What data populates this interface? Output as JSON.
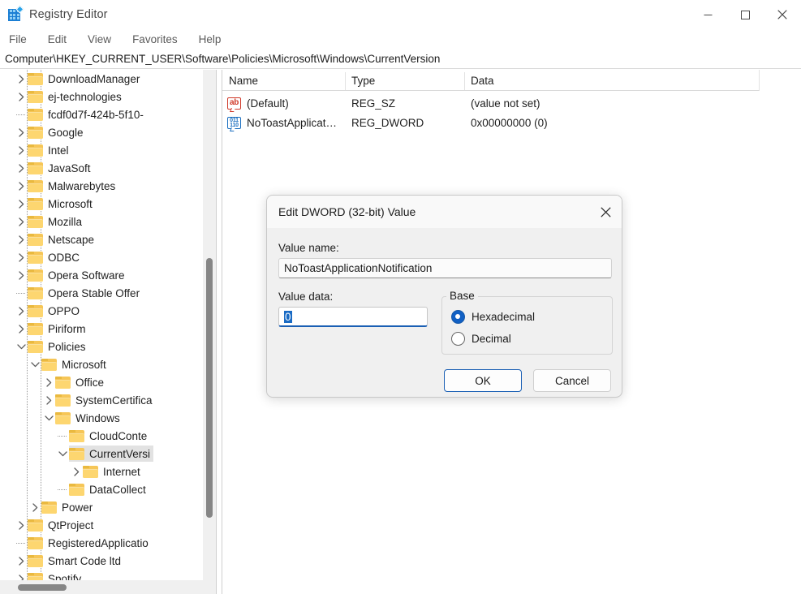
{
  "window": {
    "title": "Registry Editor",
    "icon": "registry-editor-icon",
    "controls": {
      "minimize": "minimize-icon",
      "maximize": "maximize-icon",
      "close": "close-icon"
    }
  },
  "menubar": {
    "items": [
      "File",
      "Edit",
      "View",
      "Favorites",
      "Help"
    ]
  },
  "address": {
    "path": "Computer\\HKEY_CURRENT_USER\\Software\\Policies\\Microsoft\\Windows\\CurrentVersion"
  },
  "tree": {
    "items": [
      {
        "label": "DownloadManager",
        "indent": 2,
        "state": "collapsed",
        "selected": false
      },
      {
        "label": "ej-technologies",
        "indent": 2,
        "state": "collapsed",
        "selected": false
      },
      {
        "label": "fcdf0d7f-424b-5f10-",
        "indent": 2,
        "state": "leaf",
        "selected": false
      },
      {
        "label": "Google",
        "indent": 2,
        "state": "collapsed",
        "selected": false
      },
      {
        "label": "Intel",
        "indent": 2,
        "state": "collapsed",
        "selected": false
      },
      {
        "label": "JavaSoft",
        "indent": 2,
        "state": "collapsed",
        "selected": false
      },
      {
        "label": "Malwarebytes",
        "indent": 2,
        "state": "collapsed",
        "selected": false
      },
      {
        "label": "Microsoft",
        "indent": 2,
        "state": "collapsed",
        "selected": false
      },
      {
        "label": "Mozilla",
        "indent": 2,
        "state": "collapsed",
        "selected": false
      },
      {
        "label": "Netscape",
        "indent": 2,
        "state": "collapsed",
        "selected": false
      },
      {
        "label": "ODBC",
        "indent": 2,
        "state": "collapsed",
        "selected": false
      },
      {
        "label": "Opera Software",
        "indent": 2,
        "state": "collapsed",
        "selected": false
      },
      {
        "label": "Opera Stable Offer",
        "indent": 2,
        "state": "leaf",
        "selected": false
      },
      {
        "label": "OPPO",
        "indent": 2,
        "state": "collapsed",
        "selected": false
      },
      {
        "label": "Piriform",
        "indent": 2,
        "state": "collapsed",
        "selected": false
      },
      {
        "label": "Policies",
        "indent": 2,
        "state": "expanded",
        "selected": false
      },
      {
        "label": "Microsoft",
        "indent": 3,
        "state": "expanded",
        "selected": false
      },
      {
        "label": "Office",
        "indent": 4,
        "state": "collapsed",
        "selected": false
      },
      {
        "label": "SystemCertifica",
        "indent": 4,
        "state": "collapsed",
        "selected": false
      },
      {
        "label": "Windows",
        "indent": 4,
        "state": "expanded",
        "selected": false
      },
      {
        "label": "CloudConte",
        "indent": 5,
        "state": "leaf",
        "selected": false
      },
      {
        "label": "CurrentVersi",
        "indent": 5,
        "state": "expanded",
        "selected": true
      },
      {
        "label": "Internet ",
        "indent": 6,
        "state": "collapsed",
        "selected": false
      },
      {
        "label": "DataCollect",
        "indent": 5,
        "state": "leaf",
        "selected": false
      },
      {
        "label": "Power",
        "indent": 3,
        "state": "collapsed",
        "selected": false
      },
      {
        "label": "QtProject",
        "indent": 2,
        "state": "collapsed",
        "selected": false
      },
      {
        "label": "RegisteredApplicatio",
        "indent": 2,
        "state": "leaf",
        "selected": false
      },
      {
        "label": "Smart Code ltd",
        "indent": 2,
        "state": "collapsed",
        "selected": false
      },
      {
        "label": "Spotify",
        "indent": 2,
        "state": "collapsed",
        "selected": false
      }
    ]
  },
  "values": {
    "columns": [
      "Name",
      "Type",
      "Data"
    ],
    "rows": [
      {
        "icon": "string-value-icon",
        "name": "(Default)",
        "type": "REG_SZ",
        "data": "(value not set)"
      },
      {
        "icon": "dword-value-icon",
        "name": "NoToastApplicat…",
        "type": "REG_DWORD",
        "data": "0x00000000 (0)"
      }
    ]
  },
  "dialog": {
    "title": "Edit DWORD (32-bit) Value",
    "close_icon": "close-icon",
    "value_name_label": "Value name:",
    "value_name": "NoToastApplicationNotification",
    "value_data_label": "Value data:",
    "value_data": "0",
    "base_label": "Base",
    "base_options": [
      {
        "label": "Hexadecimal",
        "selected": true
      },
      {
        "label": "Decimal",
        "selected": false
      }
    ],
    "ok_label": "OK",
    "cancel_label": "Cancel"
  },
  "colors": {
    "accent": "#1a5fb4",
    "selection": "#1a6bc4",
    "folder": "#fdd670",
    "string_icon": "#d03a2a",
    "dword_icon": "#1b6fc0"
  }
}
